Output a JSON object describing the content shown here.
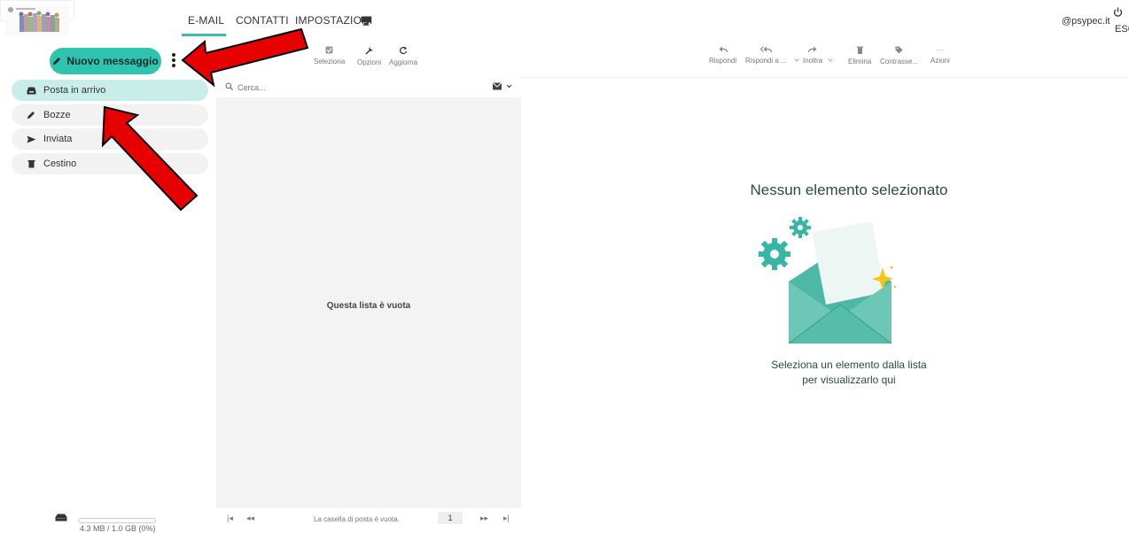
{
  "header": {
    "tabs": [
      {
        "label": "E-MAIL"
      },
      {
        "label": "CONTATTI"
      },
      {
        "label": "IMPOSTAZIONI"
      }
    ],
    "user_email": "@psypec.it",
    "logout_label": "ESC"
  },
  "sidebar": {
    "compose_label": "Nuovo messaggio",
    "folders": [
      {
        "label": "Posta in arrivo",
        "icon": "inbox-icon"
      },
      {
        "label": "Bozze",
        "icon": "pencil-icon"
      },
      {
        "label": "Inviata",
        "icon": "send-icon"
      },
      {
        "label": "Cestino",
        "icon": "trash-icon"
      }
    ],
    "storage_text": "4.3 MB / 1.0 GB (0%)",
    "storage_fraction": 0.004
  },
  "list": {
    "toolbar": {
      "select": "Seleziona",
      "options": "Opzioni",
      "refresh": "Aggiorna"
    },
    "search_placeholder": "Cerca...",
    "empty_text": "Questa lista è vuota",
    "footer_text": "La casella di posta è vuota.",
    "page_number": "1"
  },
  "reader": {
    "toolbar": {
      "reply": "Rispondi",
      "reply_all": "Rispondi a ...",
      "forward": "Inoltra",
      "delete": "Elimina",
      "tag": "Contrasse...",
      "actions": "Azioni"
    },
    "empty_title": "Nessun elemento selezionato",
    "empty_hint_line1": "Seleziona un elemento dalla lista",
    "empty_hint_line2": "per visualizzarlo qui"
  },
  "colors": {
    "accent": "#2ec4b0",
    "active_folder": "#c9eeea",
    "annotation_arrow": "#e60000"
  }
}
